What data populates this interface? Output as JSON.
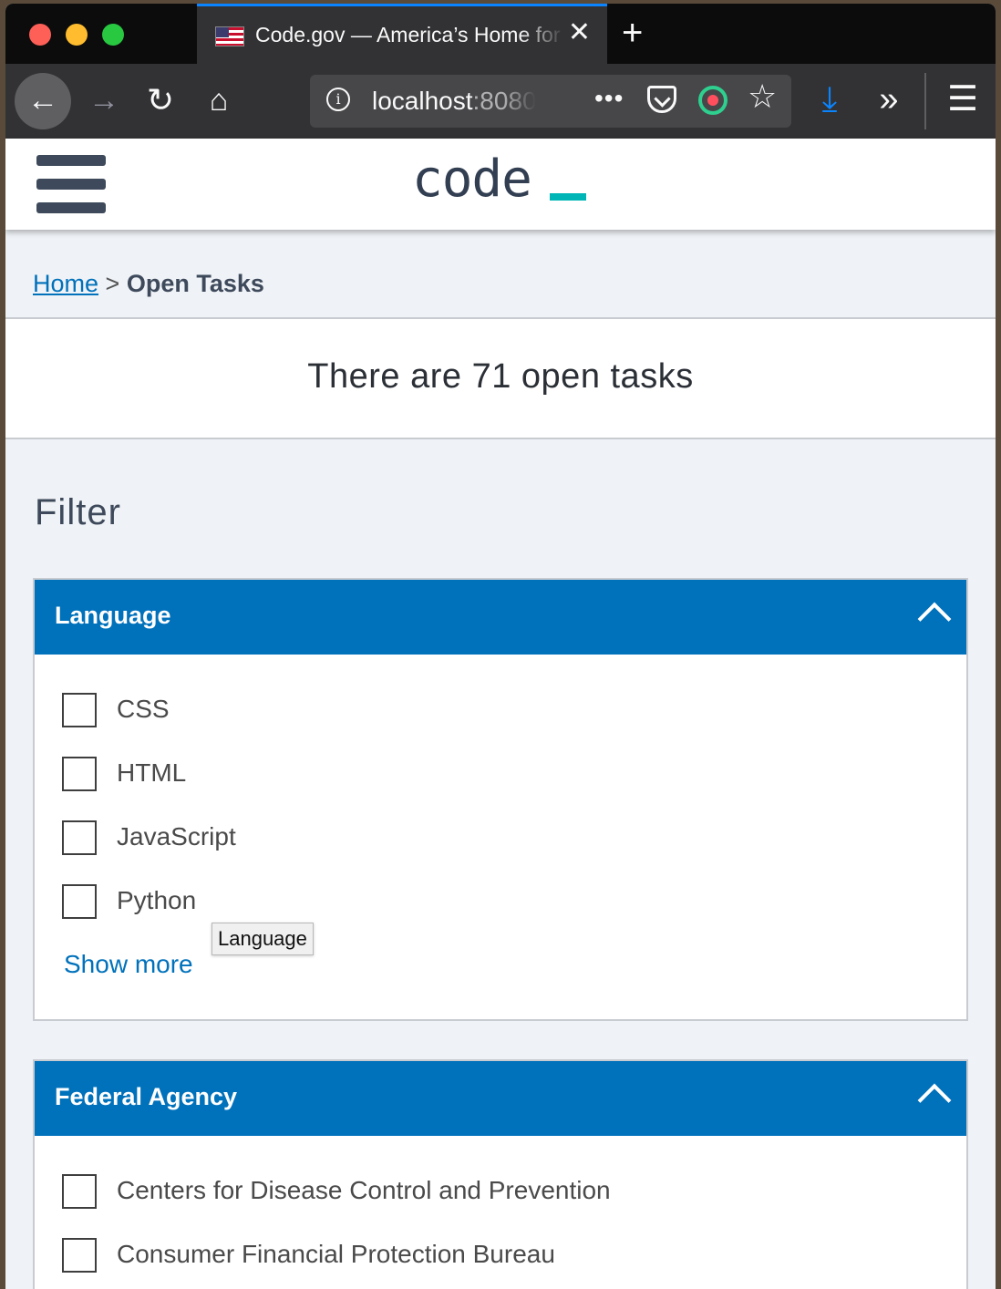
{
  "browser": {
    "tab_title": "Code.gov — America’s Home for Open Source Software",
    "tab_favicon": "us-flag-icon",
    "close_glyph": "✕",
    "new_tab_glyph": "+",
    "url_host": "localhost",
    "url_port": ":8080",
    "url_dots": "•••",
    "icons": {
      "back": "←",
      "forward": "→",
      "reload": "↻",
      "home": "⌂",
      "star": "☆",
      "download": "⤓",
      "overflow": "»",
      "menu": "☰"
    }
  },
  "site": {
    "logo_text": "code",
    "accent_color": "#0071bb",
    "logo_cursor_color": "#00b5b5"
  },
  "breadcrumb": {
    "home": "Home",
    "separator": ">",
    "current": "Open Tasks"
  },
  "summary": {
    "text": "There are 71 open tasks"
  },
  "filter": {
    "title": "Filter",
    "language": {
      "title": "Language",
      "options": [
        "CSS",
        "HTML",
        "JavaScript",
        "Python"
      ],
      "show_more": "Show more",
      "tooltip": "Language"
    },
    "agency": {
      "title": "Federal Agency",
      "options": [
        "Centers for Disease Control and Prevention",
        "Consumer Financial Protection Bureau"
      ]
    }
  }
}
